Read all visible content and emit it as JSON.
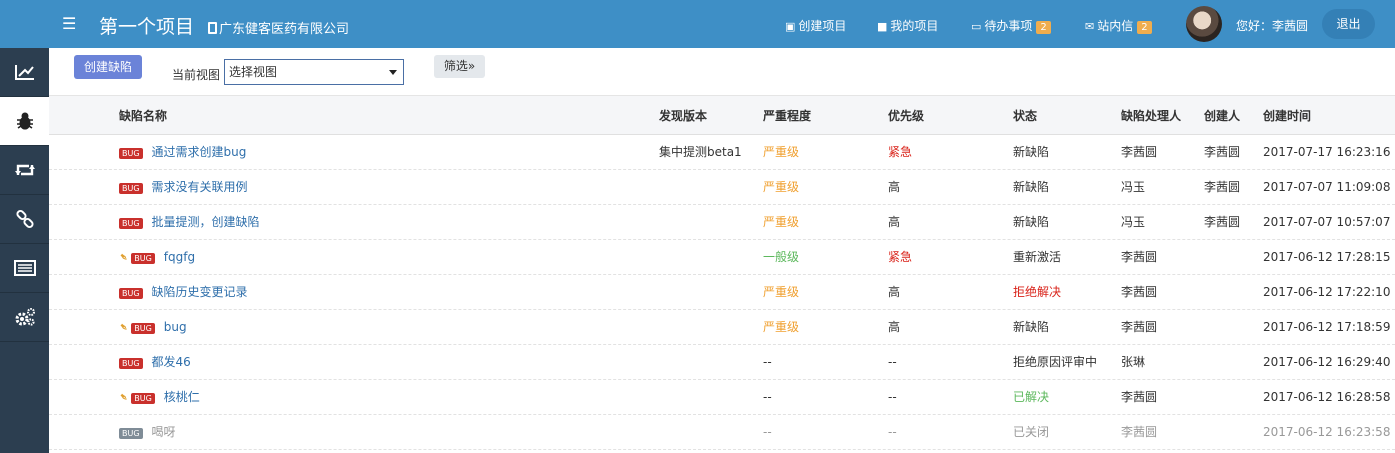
{
  "header": {
    "menu_icon": "menu-icon",
    "project_title": "第一个项目",
    "company": "广东健客医药有限公司",
    "nav": [
      {
        "label": "创建项目",
        "icon": "plus-square-icon",
        "badge": null
      },
      {
        "label": "我的项目",
        "icon": "briefcase-icon",
        "badge": null
      },
      {
        "label": "待办事项",
        "icon": "monitor-icon",
        "badge": "2"
      },
      {
        "label": "站内信",
        "icon": "envelope-icon",
        "badge": "2"
      }
    ],
    "greeting": "您好：李茜圆",
    "logout": "退出"
  },
  "sidebar": {
    "items": [
      {
        "name": "dashboard",
        "icon": "chart-icon",
        "active": false
      },
      {
        "name": "bugs",
        "icon": "bug-icon",
        "active": true
      },
      {
        "name": "sync",
        "icon": "retweet-icon",
        "active": false
      },
      {
        "name": "links",
        "icon": "link-icon",
        "active": false
      },
      {
        "name": "list",
        "icon": "list-icon",
        "active": false
      },
      {
        "name": "settings",
        "icon": "gears-icon",
        "active": false
      }
    ]
  },
  "toolbar": {
    "create_button": "创建缺陷",
    "view_label": "当前视图",
    "view_value": "选择视图",
    "filter_button": "筛选"
  },
  "table": {
    "columns": [
      "缺陷名称",
      "发现版本",
      "严重程度",
      "优先级",
      "状态",
      "缺陷处理人",
      "创建人",
      "创建时间"
    ],
    "tag": "BUG",
    "rows": [
      {
        "attachment": false,
        "title": "通过需求创建bug",
        "version": "集中提测beta1",
        "severity": "严重级",
        "sev_class": "serious",
        "priority": "紧急",
        "pri_class": "urgent",
        "status": "新缺陷",
        "st_class": "",
        "handler": "李茜圆",
        "creator": "李茜圆",
        "time": "2017-07-17 16:23:16",
        "closed": false
      },
      {
        "attachment": false,
        "title": "需求没有关联用例",
        "version": "",
        "severity": "严重级",
        "sev_class": "serious",
        "priority": "高",
        "pri_class": "",
        "status": "新缺陷",
        "st_class": "",
        "handler": "冯玉",
        "creator": "李茜圆",
        "time": "2017-07-07 11:09:08",
        "closed": false
      },
      {
        "attachment": false,
        "title": "批量提测，创建缺陷",
        "version": "",
        "severity": "严重级",
        "sev_class": "serious",
        "priority": "高",
        "pri_class": "",
        "status": "新缺陷",
        "st_class": "",
        "handler": "冯玉",
        "creator": "李茜圆",
        "time": "2017-07-07 10:57:07",
        "closed": false
      },
      {
        "attachment": true,
        "title": "fqgfg",
        "version": "",
        "severity": "一般级",
        "sev_class": "normal",
        "priority": "紧急",
        "pri_class": "urgent",
        "status": "重新激活",
        "st_class": "",
        "handler": "李茜圆",
        "creator": "",
        "time": "2017-06-12 17:28:15",
        "closed": false
      },
      {
        "attachment": false,
        "title": "缺陷历史变更记录",
        "version": "",
        "severity": "严重级",
        "sev_class": "serious",
        "priority": "高",
        "pri_class": "",
        "status": "拒绝解决",
        "st_class": "reject",
        "handler": "李茜圆",
        "creator": "",
        "time": "2017-06-12 17:22:10",
        "closed": false
      },
      {
        "attachment": true,
        "title": "bug",
        "version": "",
        "severity": "严重级",
        "sev_class": "serious",
        "priority": "高",
        "pri_class": "",
        "status": "新缺陷",
        "st_class": "",
        "handler": "李茜圆",
        "creator": "",
        "time": "2017-06-12 17:18:59",
        "closed": false
      },
      {
        "attachment": false,
        "title": "都发46",
        "version": "",
        "severity": "--",
        "sev_class": "",
        "priority": "--",
        "pri_class": "",
        "status": "拒绝原因评审中",
        "st_class": "",
        "handler": "张琳",
        "creator": "",
        "time": "2017-06-12 16:29:40",
        "closed": false
      },
      {
        "attachment": true,
        "title": "核桃仁",
        "version": "",
        "severity": "--",
        "sev_class": "",
        "priority": "--",
        "pri_class": "",
        "status": "已解决",
        "st_class": "resolved",
        "handler": "李茜圆",
        "creator": "",
        "time": "2017-06-12 16:28:58",
        "closed": false
      },
      {
        "attachment": false,
        "title": "喝呀",
        "version": "",
        "severity": "--",
        "sev_class": "",
        "priority": "--",
        "pri_class": "",
        "status": "已关闭",
        "st_class": "",
        "handler": "李茜圆",
        "creator": "",
        "time": "2017-06-12 16:23:58",
        "closed": true
      }
    ]
  }
}
